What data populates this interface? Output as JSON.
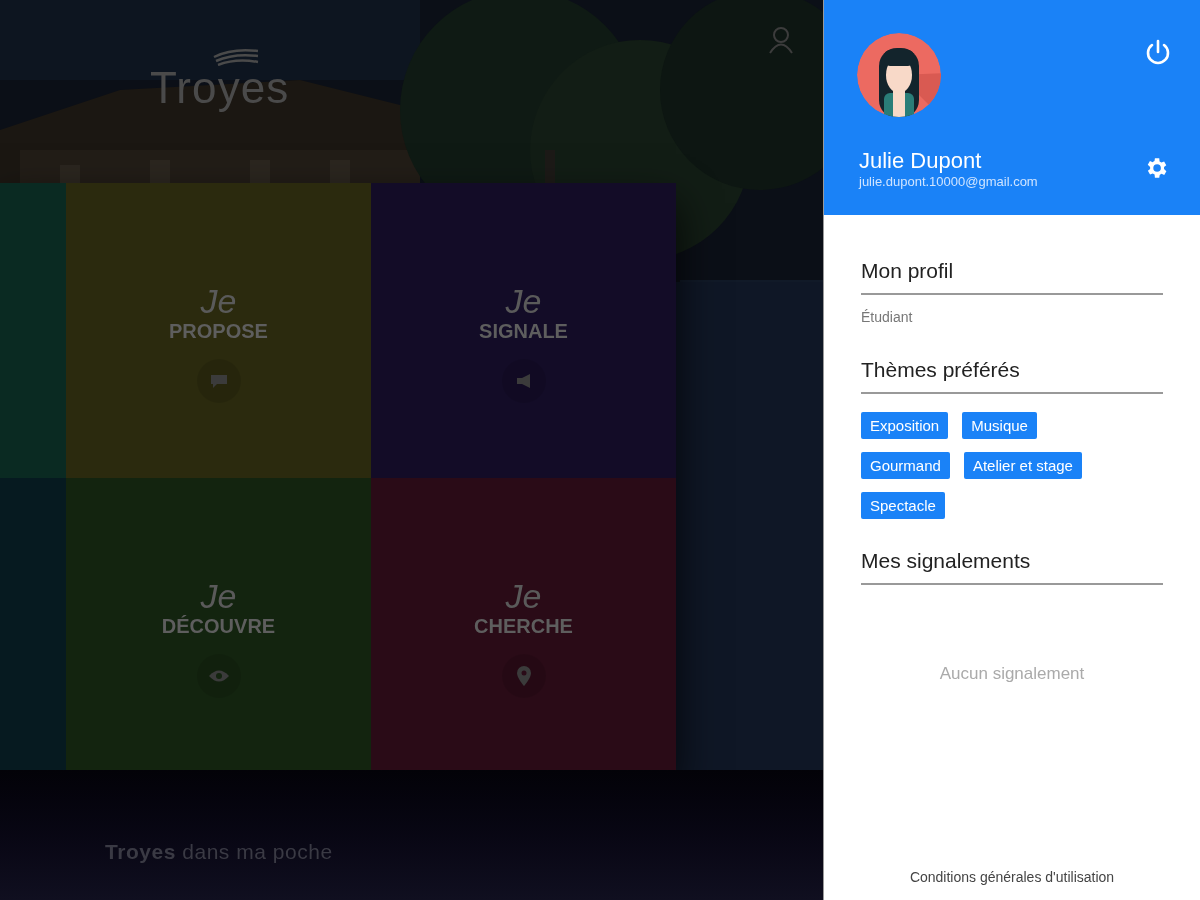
{
  "app": {
    "logo": "Troyes",
    "tagline": "**Troyes** dans ma poche"
  },
  "tiles": [
    {
      "kind": "propose",
      "prefix": "Je",
      "label": "PROPOSE",
      "color": "#2b2a0e"
    },
    {
      "kind": "signale",
      "prefix": "Je",
      "label": "SIGNALE",
      "color": "#130c27"
    },
    {
      "kind": "decouvre",
      "prefix": "Je",
      "label": "DÉCOUVRE",
      "color": "#13240f"
    },
    {
      "kind": "cherche",
      "prefix": "Je",
      "label": "CHERCHE",
      "color": "#2a0b17"
    }
  ],
  "drawer": {
    "user": {
      "name": "Julie Dupont",
      "email": "julie.dupont.10000@gmail.com"
    },
    "sections": [
      {
        "title": "Mon profil",
        "text": "Étudiant"
      },
      {
        "title": "Thèmes préférés",
        "tags": [
          "Exposition",
          "Musique",
          "Gourmand",
          "Atelier et stage",
          "Spectacle"
        ]
      },
      {
        "title": "Mes signalements",
        "empty": "Aucun signalement"
      }
    ],
    "footer_link": "Conditions générales d'utilisation"
  }
}
